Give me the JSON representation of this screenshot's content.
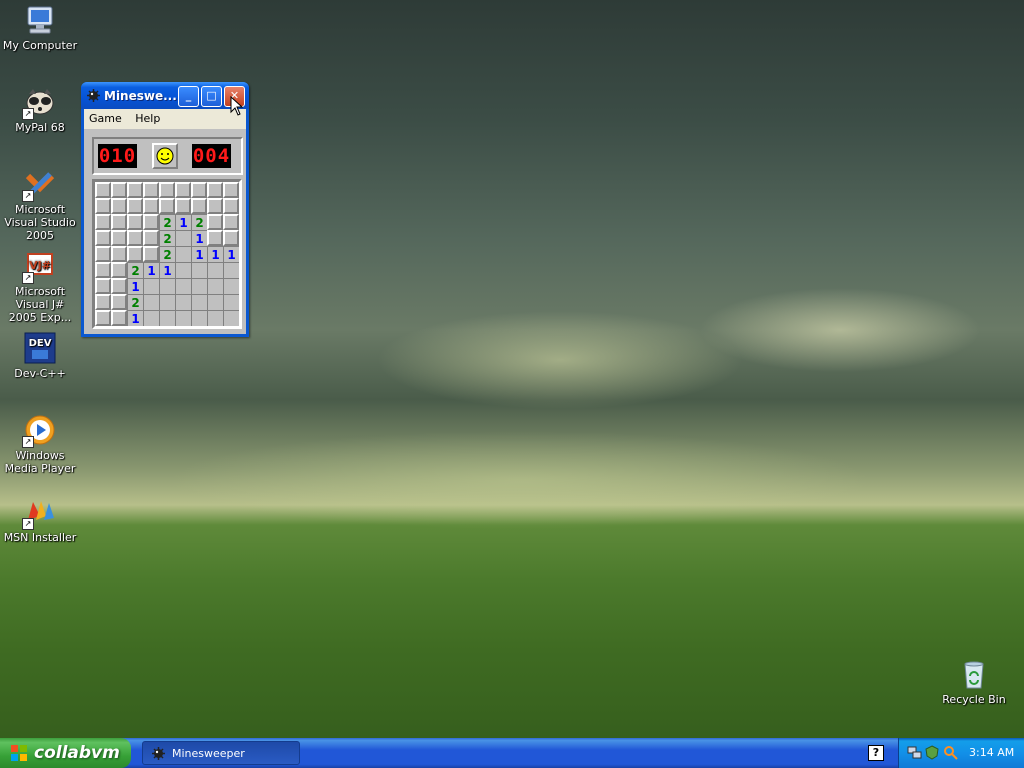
{
  "desktop": {
    "icons": [
      {
        "label": "My Computer",
        "icon": "computer-icon"
      },
      {
        "label": "MyPal 68",
        "icon": "mypal-icon"
      },
      {
        "label": "Microsoft Visual Studio 2005",
        "icon": "visual-studio-icon"
      },
      {
        "label": "Microsoft Visual J# 2005 Exp...",
        "icon": "vjsharp-icon"
      },
      {
        "label": "Dev-C++",
        "icon": "devcpp-icon"
      },
      {
        "label": "Windows Media Player",
        "icon": "media-player-icon"
      },
      {
        "label": "MSN Installer",
        "icon": "msn-icon"
      },
      {
        "label": "Recycle Bin",
        "icon": "recycle-bin-icon"
      }
    ]
  },
  "minesweeper": {
    "title": "Minesweeper",
    "title_shown": "Mineswe...",
    "menu": [
      "Game",
      "Help"
    ],
    "mines_counter": "010",
    "timer": "004",
    "board": [
      "#########",
      "#########",
      "####212##",
      "####2.1##",
      "####2.111",
      "##211....",
      "##1......",
      "##2......",
      "##1......"
    ]
  },
  "taskbar": {
    "start_label": "collabvm",
    "task_label": "Minesweeper",
    "help_glyph": "?",
    "clock": "3:14 AM"
  },
  "colors": {
    "taskbar_blue": "#2157d7",
    "start_green": "#37a137",
    "lcd_red": "#ff1a1a",
    "num1": "#0000ff",
    "num2": "#008000"
  }
}
